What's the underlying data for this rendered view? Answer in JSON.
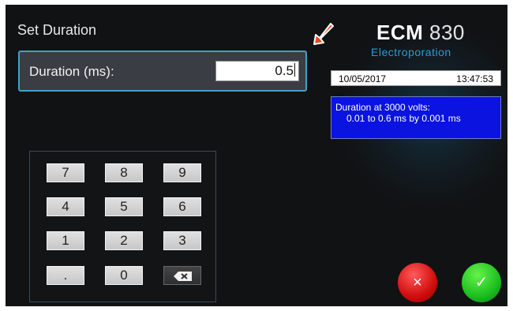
{
  "screen": {
    "title": "Set Duration",
    "duration_label": "Duration (ms):",
    "duration_value": "0.5",
    "brand_prefix": "ECM",
    "brand_model": "830",
    "brand_subtitle": "Electroporation",
    "date": "10/05/2017",
    "time": "13:47:53",
    "info_line1": "Duration at 3000 volts:",
    "info_line2": "0.01 to 0.6 ms by 0.001 ms"
  },
  "keypad": {
    "keys": [
      "7",
      "8",
      "9",
      "4",
      "5",
      "6",
      "1",
      "2",
      "3",
      ".",
      "0"
    ],
    "backspace_icon": "backspace-icon"
  },
  "actions": {
    "cancel_label": "×",
    "confirm_label": "✓"
  },
  "colors": {
    "screen_bg": "#111213",
    "duration_panel_border": "#3fa3c6",
    "info_bg": "#0b13e0",
    "cancel": "#d10d0d",
    "confirm": "#1bbf1f",
    "arrow": "#e8471d"
  }
}
